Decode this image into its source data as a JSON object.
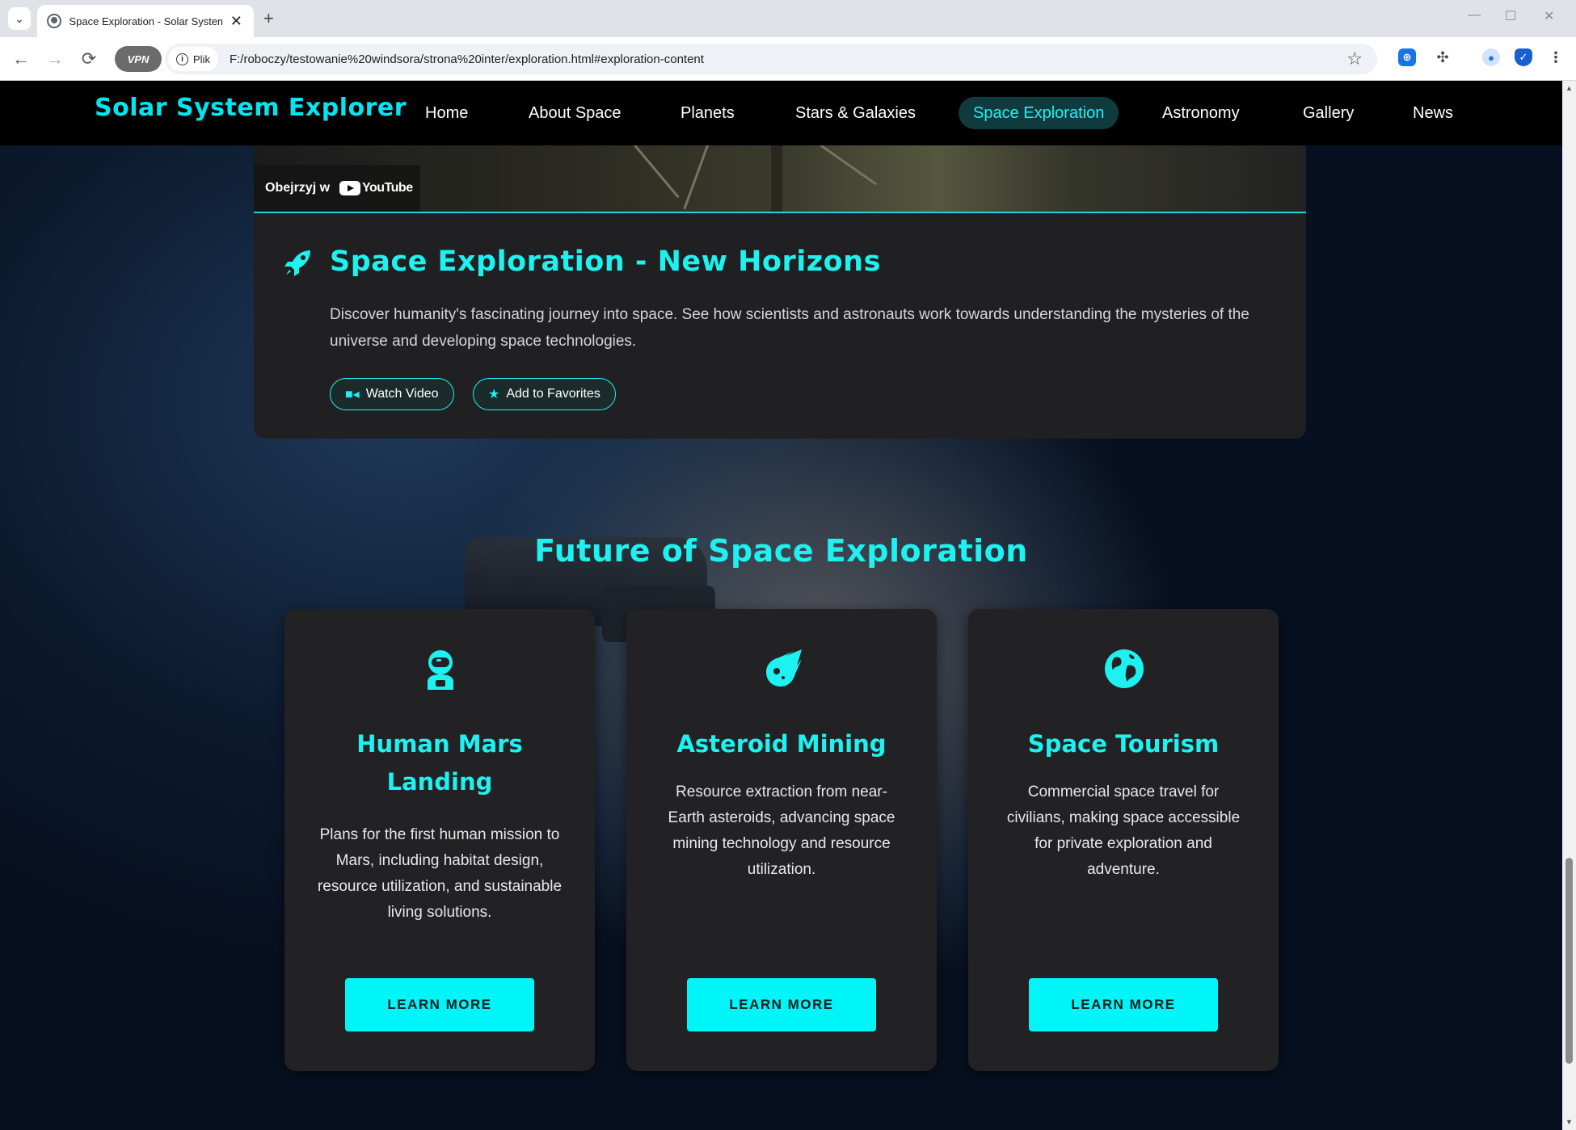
{
  "browser": {
    "tab_title": "Space Exploration - Solar System E",
    "new_tab": "+",
    "tab_close": "✕",
    "site_info_label": "Plik",
    "vpn_label": "VPN",
    "url": "F:/roboczy/testowanie%20windsora/strona%20inter/exploration.html#exploration-content"
  },
  "site": {
    "brand": "Solar System Explorer",
    "nav": [
      {
        "label": "Home"
      },
      {
        "label": "About Space"
      },
      {
        "label": "Planets"
      },
      {
        "label": "Stars & Galaxies"
      },
      {
        "label": "Space Exploration",
        "active": true
      },
      {
        "label": "Astronomy"
      },
      {
        "label": "Gallery"
      },
      {
        "label": "News"
      }
    ]
  },
  "video_card": {
    "watch_on": "Obejrzyj w",
    "youtube": "YouTube",
    "title": "Space Exploration - New Horizons",
    "description": "Discover humanity's fascinating journey into space. See how scientists and astronauts work towards understanding the mysteries of the universe and developing space technologies.",
    "watch_video": "Watch Video",
    "add_favorites": "Add to Favorites"
  },
  "future": {
    "title": "Future of Space Exploration",
    "cards": [
      {
        "icon": "astronaut-icon",
        "title": "Human Mars Landing",
        "description": "Plans for the first human mission to Mars, including habitat design, resource utilization, and sustainable living solutions.",
        "button": "LEARN MORE"
      },
      {
        "icon": "meteor-icon",
        "title": "Asteroid Mining",
        "description": "Resource extraction from near-Earth asteroids, advancing space mining technology and resource utilization.",
        "button": "LEARN MORE"
      },
      {
        "icon": "globe-icon",
        "title": "Space Tourism",
        "description": "Commercial space travel for civilians, making space accessible for private exploration and adventure.",
        "button": "LEARN MORE"
      }
    ]
  },
  "colors": {
    "accent": "#1ef2f0",
    "button": "#00f5f8",
    "card_bg": "#222224",
    "nav_bg": "#000000"
  }
}
